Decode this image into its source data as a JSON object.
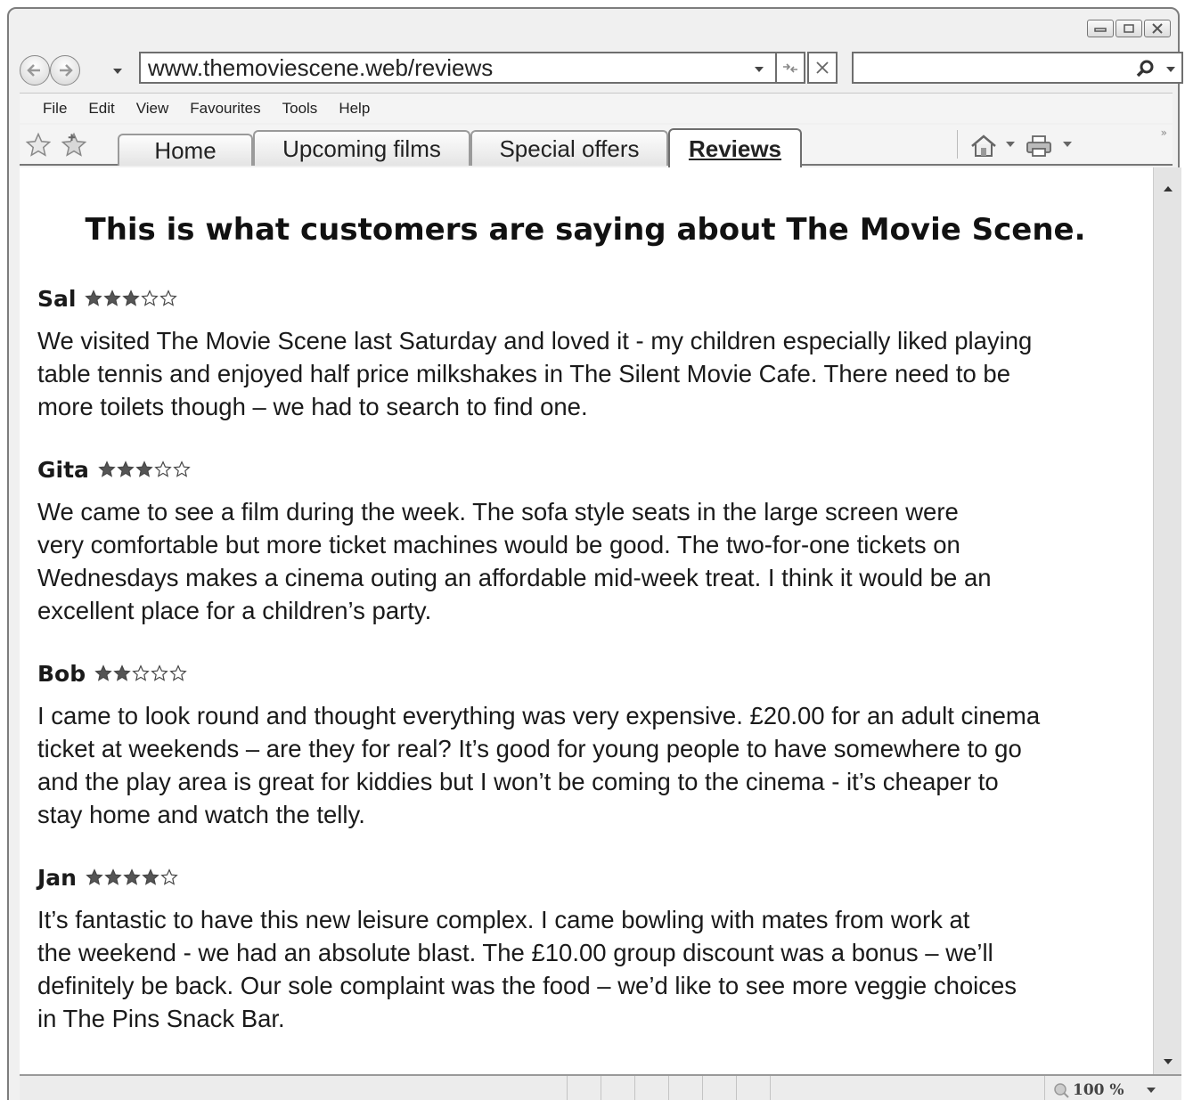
{
  "browser": {
    "url": "www.themoviescene.web/reviews",
    "search_value": "",
    "menu": [
      "File",
      "Edit",
      "View",
      "Favourites",
      "Tools",
      "Help"
    ],
    "tabs": [
      {
        "label": "Home"
      },
      {
        "label": "Upcoming films"
      },
      {
        "label": "Special offers"
      },
      {
        "label": "Reviews"
      }
    ],
    "active_tab": "Reviews",
    "zoom": "100 %"
  },
  "page": {
    "title": "This is what customers are saying about The Movie Scene.",
    "reviews": [
      {
        "name": "Sal",
        "rating": 3,
        "max_rating": 5,
        "text": "We visited The Movie Scene last Saturday and loved it - my children especially liked playing\ntable tennis and enjoyed half price milkshakes in The Silent Movie Cafe. There need to be\nmore toilets though – we had to search to find one."
      },
      {
        "name": "Gita",
        "rating": 3,
        "max_rating": 5,
        "text": "We came to see a film during the week. The sofa style seats in the large screen were\nvery comfortable but more ticket machines would be good. The two-for-one tickets on\nWednesdays makes a cinema outing an affordable mid-week treat. I think it would be an\nexcellent place for a children’s party."
      },
      {
        "name": "Bob",
        "rating": 2,
        "max_rating": 5,
        "text": "I came to look round and thought everything was very expensive. £20.00 for an adult cinema\nticket at weekends – are they for real? It’s good for young people to have somewhere to go\nand the play area is great for kiddies but I won’t be coming to the cinema - it’s cheaper to\nstay home and watch the telly."
      },
      {
        "name": "Jan",
        "rating": 4,
        "max_rating": 5,
        "text": "It’s fantastic to have this new leisure complex. I came bowling with mates from work at\nthe weekend - we had an absolute blast. The £10.00 group discount was a bonus – we’ll\ndefinitely be back. Our sole complaint was the food – we’d like to see more veggie choices\nin The Pins Snack Bar."
      }
    ]
  },
  "colors": {
    "star_filled": "#555555",
    "star_empty": "#ffffff",
    "chrome_gray": "#f0f0f0"
  },
  "icons": {
    "back": "back-arrow-icon",
    "forward": "forward-arrow-icon",
    "refresh": "refresh-icon",
    "stop": "close-icon",
    "search": "search-icon",
    "favorites": "star-icon",
    "add_favorite": "add-favorite-icon",
    "home": "home-icon",
    "print": "print-icon",
    "zoom": "zoom-icon"
  }
}
